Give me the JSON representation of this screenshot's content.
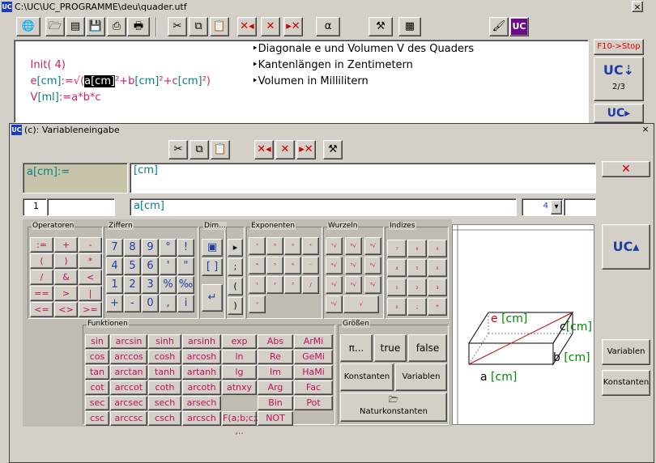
{
  "main_window": {
    "title": "C:\\UC\\UC_PROGRAMME\\deu\\quader.utf",
    "close": "×",
    "alpha_label": "α",
    "code_lines": [
      {
        "a": "Init( ",
        "b": "4",
        "c": ")"
      },
      {
        "lhs": "e",
        "unit1": "[cm]",
        "op": ":=",
        "root": "√(",
        "sel": "a[cm]",
        "rest1": "²+b",
        "u2": "[cm]",
        "rest2": "²+c",
        "u3": "[cm]",
        "rest3": "²)"
      },
      {
        "lhs": "V",
        "unit1": "[ml]",
        "op": ":=",
        "expr": "a*b*c"
      }
    ],
    "comments": [
      "‣Diagonale e und Volumen V des Quaders",
      "‣Kantenlängen in Zentimetern",
      "‣Volumen in Millilitern"
    ],
    "stop_label": "F10->Stop",
    "page_label": "2/3"
  },
  "dialog": {
    "title": "(c): Variableneingabe",
    "close": "×",
    "var_label": "a[cm]:=",
    "var_value": "[cm]",
    "cancel_glyph": "✕",
    "line_no": "1",
    "expr_field": "a[cm]",
    "digits": "4",
    "dropdown_arrow": "▾",
    "groups": {
      "operatoren": "Operatoren",
      "ziffern": "Ziffern",
      "dim": "Dim...",
      "exponenten": "Exponenten",
      "wurzeln": "Wurzeln",
      "indizes": "Indizes",
      "funktionen": "Funktionen",
      "groessen": "Größen"
    },
    "operatoren": [
      ":=",
      "+",
      "-",
      "(",
      ")",
      "*",
      "/",
      "&",
      "<",
      "==",
      ">",
      "|",
      "<=",
      "<>",
      ">="
    ],
    "ziffern": [
      "7",
      "8",
      "9",
      "°",
      "!",
      "4",
      "5",
      "6",
      "'",
      "\"",
      "1",
      "2",
      "3",
      "%",
      "‰",
      "+",
      "-",
      "0",
      ",",
      "i"
    ],
    "dim_keys": [
      "▣",
      "[ ]",
      "↵"
    ],
    "misc_keys": [
      "▸",
      ";",
      "(",
      ")"
    ],
    "exponenten": [
      "⁷",
      "⁸",
      "⁹",
      "⁺",
      "⁴",
      "⁵",
      "⁶",
      "⁻",
      "¹",
      "²",
      "³",
      "/",
      "⁰"
    ],
    "wurzeln": [
      "⁷√",
      "⁸√",
      "⁹√",
      "⁴√",
      "⁵√",
      "⁶√",
      "¹√",
      "²√",
      "³√",
      "⁰√",
      "√"
    ],
    "indizes": [
      "₇",
      "₈",
      "₉",
      "₄",
      "₅",
      "₆",
      "₁",
      "₂",
      "₃",
      "₀",
      ";",
      "*"
    ],
    "funktionen": [
      "sin",
      "arcsin",
      "sinh",
      "arsinh",
      "exp",
      "Abs",
      "ArMi",
      "cos",
      "arccos",
      "cosh",
      "arcosh",
      "ln",
      "Re",
      "GeMi",
      "tan",
      "arctan",
      "tanh",
      "artanh",
      "lg",
      "Im",
      "HaMi",
      "cot",
      "arccot",
      "coth",
      "arcoth",
      "atnxy",
      "Arg",
      "Fac",
      "sec",
      "arcsec",
      "sech",
      "arsech",
      "",
      "Bin",
      "Pot",
      "csc",
      "arccsc",
      "csch",
      "arcsch",
      "F(a;b;c;z) ,..",
      "NOT"
    ],
    "groessen": {
      "pi": "π...",
      "true": "true",
      "false": "false",
      "konst": "Konstanten",
      "var": "Variablen",
      "natur": "Naturkonstanten",
      "natur_icon": "🗁"
    },
    "side_buttons": [
      "Variablen",
      "Konstanten"
    ],
    "figure": {
      "e": "e",
      "e_unit": "[cm]",
      "c": "c",
      "c_unit": "[cm]",
      "b": "b",
      "b_unit": "[cm]",
      "a": "a",
      "a_unit": "[cm]"
    }
  }
}
